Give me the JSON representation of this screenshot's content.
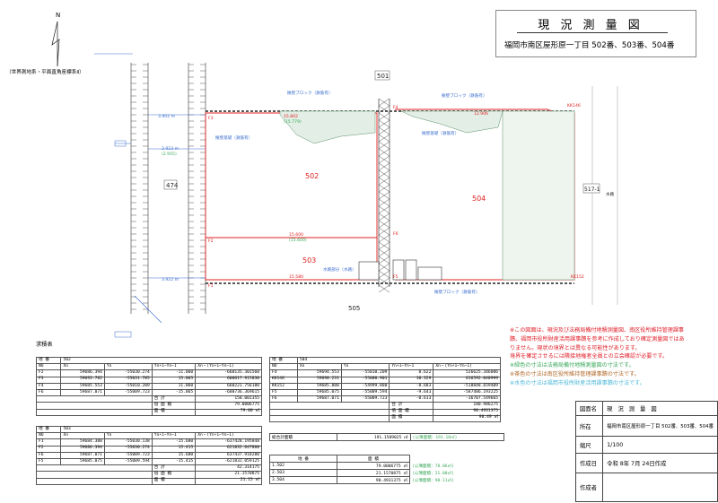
{
  "title": "現 況 測 量 図",
  "subtitle": "福岡市南区屋形原一丁目 502番、503番、504番",
  "north": "N",
  "coord_system": "（世界測地系・平面直角座標系Ⅱ）",
  "parcels": {
    "p501": "501",
    "p502": "502",
    "p503": "503",
    "p504": "504",
    "p505": "505",
    "p474": "474",
    "p517": "517-1"
  },
  "map_labels": {
    "b1": "3.902 m",
    "b2": "2.923 m",
    "b2b": "(2.955)",
    "b3": "3.922 m",
    "b4": "2.450",
    "f1": "F1",
    "f2": "F2",
    "f3": "F3",
    "f4": "F4",
    "f5": "F5",
    "f6": "F6",
    "kk146": "KK146",
    "kk152": "KK152",
    "d1": "15.802",
    "d1b": "(15.779)",
    "d2": "12.906",
    "d3": "15.600",
    "d3b": "(15.600)",
    "d4": "15.580",
    "road": "水路",
    "block1": "擁壁ブロック（鉄筋有）",
    "block2": "擁壁ブロック（鉄筋有）",
    "block3": "擁壁ブロック（鉄筋有）",
    "area_label": "水路部分（水路）",
    "fence": "擁壁基礎（鉄筋有）",
    "fence2": "擁壁基礎（鉄筋有）"
  },
  "table_title": "求積表",
  "col_heads": [
    "NO",
    "Xn",
    "Yn",
    "Yn+1−Yn−1",
    "Xn・(Yn+1−Yn−1)"
  ],
  "goukei": "合 計",
  "bai": "倍 面 積",
  "menseki": "面 積",
  "chiban": "地 番",
  "t502": {
    "label": "502",
    "rows": [
      [
        "F2",
        "59686.394",
        "-55030.274",
        "-11.060",
        "-660135.301560"
      ],
      [
        "F3",
        "59693.782",
        "-55031.785",
        "15.065",
        "600617.915830"
      ],
      [
        "F4",
        "59685.553",
        "-55010.209",
        "11.060",
        "660221.756180"
      ],
      [
        "F6",
        "59687.071",
        "-55009.723",
        "-15.065",
        "-600736.369615"
      ]
    ],
    "sum": "158.001355",
    "double": "79.0006775",
    "area": "79.00 ㎡"
  },
  "t503": {
    "label": "503",
    "rows": [
      [
        "F1",
        "59684.388",
        "-55030.138",
        "-15.680",
        "-637428.195848"
      ],
      [
        "F2",
        "59686.394",
        "-55030.274",
        "15.415",
        "621832.647860"
      ],
      [
        "F6",
        "59687.071",
        "-55009.723",
        "15.680",
        "637437.918280"
      ],
      [
        "F5",
        "59685.075",
        "-55009.594",
        "-15.415",
        "-621832.059125"
      ]
    ],
    "sum": "42.314175",
    "double": "21.1570875",
    "area": "21.15 ㎡"
  },
  "t504": {
    "label": "504",
    "rows": [
      [
        "F4",
        "59694.553",
        "-55010.209",
        "8.622",
        "526625.346086"
      ],
      [
        "KK146",
        "59690.231",
        "-55000.901",
        "10.329",
        "616592.040999"
      ],
      [
        "KK152",
        "59685.880",
        "-54999.880",
        "-8.683",
        "-518848.659409"
      ],
      [
        "F5",
        "59685.075",
        "-55009.594",
        "-9.643",
        "-587486.193225"
      ],
      [
        "F6",
        "59687.071",
        "-55009.723",
        "-0.613",
        "-36707.549665"
      ]
    ],
    "sum": "180.986275",
    "double": "90.4931375",
    "area": "90.49 ㎡"
  },
  "summary": {
    "total_label": "総合計面積",
    "total": "191.1509025 ㎡",
    "total_note": "(公簿面積：191.18㎡)",
    "head1": "地 番",
    "head2": "面 積",
    "rows": [
      [
        "1.502",
        "79.0006775 ㎡",
        "(公簿面積：78.06㎡)"
      ],
      [
        "2.503",
        "21.1570875 ㎡",
        "(公簿面積：21.00㎡)"
      ],
      [
        "3.504",
        "90.4931375 ㎡",
        "(公簿面積：90.11㎡)"
      ]
    ]
  },
  "notes": [
    "※この図面は、現況及び法務局備付地積測量図、南区役所維持管理課事",
    "蹟、福岡市役所財産活用課事蹟を参考に作成しており確定測量図ではあ",
    "りません。現状の境界とは異なる可能性があります。",
    "境界を確定させるには隣接地権者全員との立会確認が必要です。",
    "※緑色の寸法は法務局備付地積測量図の寸法です。",
    "※茶色の寸法は南区役所維持管理課事蹟の寸法です。",
    "※水色の寸法は福岡市役所財産活用課事蹟の寸法です。"
  ],
  "note_colors": [
    "#e0202a",
    "#e0202a",
    "#e0202a",
    "#e0202a",
    "#3aa85a",
    "#b06a2a",
    "#4fb8d8"
  ],
  "info": {
    "name_label": "図面名",
    "name": "現 況 測 量 図",
    "loc_label": "所在",
    "loc": "福岡市南区屋形原一丁目 502番、503番、504番",
    "scale_label": "縮尺",
    "scale": "1/100",
    "date_label": "作成日",
    "date": "令和 8年 7月 24日作成",
    "author_label": "作成者",
    "author": ""
  }
}
